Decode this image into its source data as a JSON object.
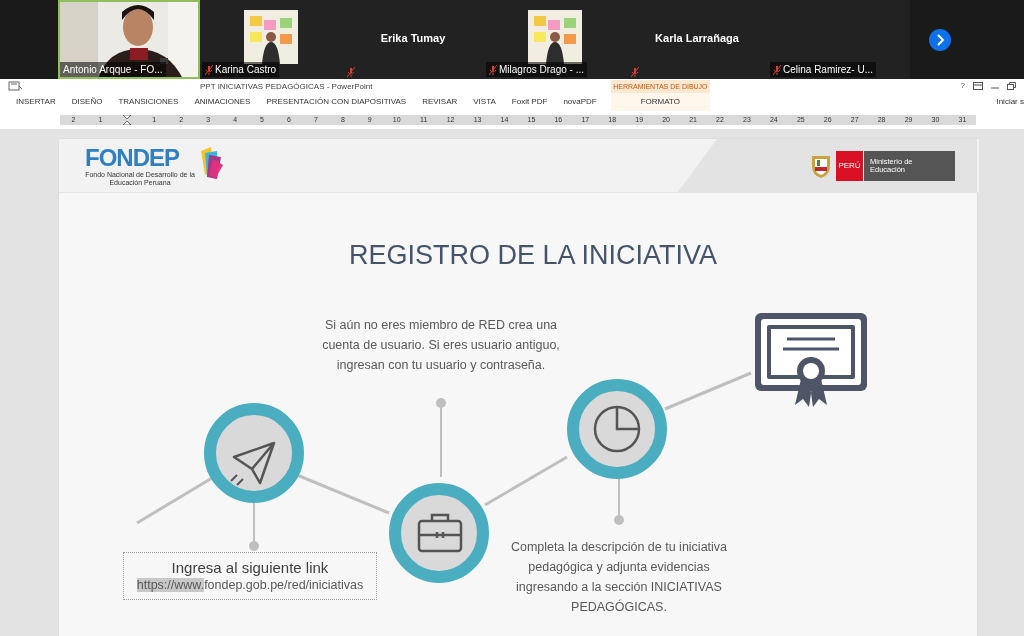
{
  "meeting": {
    "participants": [
      {
        "name": "Antonio Arqque - FO...",
        "kind": "video",
        "muted": false,
        "speaking": true
      },
      {
        "name": "Karina Castro",
        "muted": true,
        "speaking": false
      },
      {
        "name": "Erika Tumay",
        "kind": "name_only",
        "muted": true,
        "speaking": false
      },
      {
        "name": "Milagros Drago - ...",
        "muted": true,
        "speaking": false
      },
      {
        "name": "Karla Larrañaga",
        "kind": "name_only",
        "muted": true,
        "speaking": false
      },
      {
        "name": "Celina Ramirez- U...",
        "kind": "label_only",
        "muted": true,
        "speaking": false
      }
    ]
  },
  "window": {
    "title": "PPT INICIATIVAS PEDAGÓGICAS - PowerPoint",
    "window_controls": [
      "?"
    ],
    "signin": "Iniciar s"
  },
  "ribbon": {
    "tabs": [
      {
        "label": "INSERTAR",
        "selected": false
      },
      {
        "label": "DISEÑO",
        "selected": false
      },
      {
        "label": "TRANSICIONES",
        "selected": false
      },
      {
        "label": "ANIMACIONES",
        "selected": false
      },
      {
        "label": "PRESENTACIÓN CON DIAPOSITIVAS",
        "selected": false
      },
      {
        "label": "REVISAR",
        "selected": false
      },
      {
        "label": "VISTA",
        "selected": false
      },
      {
        "label": "Foxit PDF",
        "selected": false
      },
      {
        "label": "novaPDF",
        "selected": false
      },
      {
        "label": "FORMATO",
        "selected": false,
        "context": "HERRAMIENTAS DE DIBUJO"
      }
    ]
  },
  "ruler": {
    "left_labels": [
      "2",
      "1"
    ],
    "right_labels": [
      "1",
      "2",
      "3",
      "4",
      "5",
      "6",
      "7",
      "8",
      "9",
      "10",
      "11",
      "12",
      "13",
      "14",
      "15",
      "16",
      "17",
      "18",
      "19",
      "20",
      "21",
      "22",
      "23",
      "24",
      "25",
      "26",
      "27",
      "28",
      "29",
      "30",
      "31"
    ]
  },
  "slide": {
    "logo": {
      "name": "FONDEP",
      "subtitle": "Fondo Nacional de Desarrollo de la Educación Peruana"
    },
    "ministry": {
      "country": "PERÚ",
      "name": "Ministerio de Educación"
    },
    "title": "REGISTRO DE LA INICIATIVA",
    "step_text_top": "Si aún no eres miembro de RED crea una cuenta de usuario. Si eres usuario antiguo, ingresan con tu usuario y contraseña.",
    "step_text_bottom": "Completa la descripción de tu iniciativa pedagógica y adjunta evidencias ingresando a la sección INICIATIVAS PEDAGÓGICAS.",
    "link_box": {
      "heading": "Ingresa al siguiente link",
      "url_parts": [
        {
          "text": "https://www.",
          "selected": true
        },
        {
          "text": "fondep.gob.pe/red/iniciativas",
          "selected": false
        }
      ],
      "selected": true
    }
  }
}
